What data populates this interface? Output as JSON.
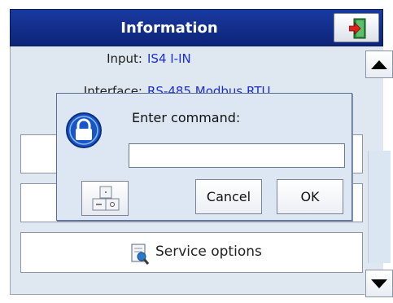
{
  "header": {
    "title": "Information",
    "exit_icon": "exit-door-icon"
  },
  "info": {
    "rows": [
      {
        "label": "Input:",
        "value": "IS4 I-IN"
      },
      {
        "label": "Interface:",
        "value": "RS-485 Modbus RTU"
      }
    ]
  },
  "service": {
    "label": "Service options",
    "icon": "service-wrench-icon"
  },
  "scrollbar": {
    "up_icon": "arrow-up-icon",
    "down_icon": "arrow-down-icon"
  },
  "dialog": {
    "prompt": "Enter command:",
    "input_value": "",
    "lock_icon": "lock-icon",
    "keyboard_icon": "keyboard-icon",
    "cancel_label": "Cancel",
    "ok_label": "OK"
  },
  "colors": {
    "header_bg": "#1a3aa0",
    "value_text": "#1b2fd0",
    "panel_bg": "#dfe7f1",
    "dialog_bg": "#dde7f3"
  }
}
